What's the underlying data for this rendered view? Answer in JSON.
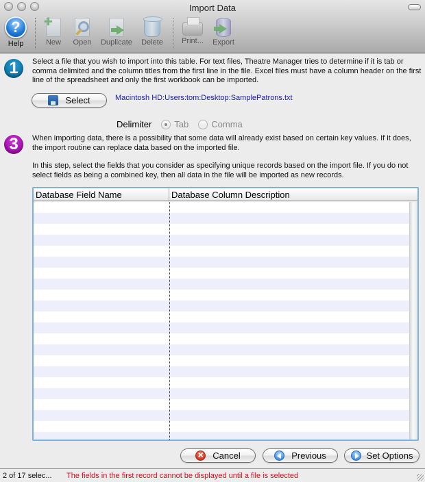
{
  "window": {
    "title": "Import Data"
  },
  "toolbar": {
    "items": [
      {
        "label": "Help",
        "icon": "help-icon",
        "enabled": true
      },
      {
        "label": "New",
        "icon": "new-document-icon",
        "enabled": false
      },
      {
        "label": "Open",
        "icon": "open-magnifier-icon",
        "enabled": false
      },
      {
        "label": "Duplicate",
        "icon": "duplicate-icon",
        "enabled": false
      },
      {
        "label": "Delete",
        "icon": "trash-icon",
        "enabled": false
      },
      {
        "label": "Print...",
        "icon": "printer-icon",
        "enabled": false
      },
      {
        "label": "Export",
        "icon": "export-database-icon",
        "enabled": false
      }
    ]
  },
  "step1": {
    "number": "1",
    "color": "#0a6f9e",
    "text": "Select a file that you wish to import into this table.  For text files, Theatre Manager tries to determine if it is tab or comma delimited and the column titles from the first line in the file.  Excel files must have a column header on the first line of the spreadsheet and only the first workbook can be imported.",
    "select_label": "Select",
    "file_path": "Macintosh HD:Users:tom:Desktop:SamplePatrons.txt",
    "delimiter_label": "Delimiter",
    "delimiter_options": [
      {
        "label": "Tab",
        "selected": true
      },
      {
        "label": "Comma",
        "selected": false
      }
    ]
  },
  "step3": {
    "number": "3",
    "color": "#9b0aa4",
    "text1": "When importing data, there is a possibility that some data will already exist based on certain key values.  If it does, the import routine can replace data based on the imported file.",
    "text2": "In this step, select the fields that you consider as specifying unique records based on the import file.   If you do not select fields as being a combined key, then all data in the file will be imported as new records."
  },
  "table": {
    "columns": [
      "Database Field Name",
      "Database Column Description"
    ],
    "rows": []
  },
  "buttons": {
    "cancel": "Cancel",
    "previous": "Previous",
    "set_options": "Set Options"
  },
  "status": {
    "count": "2 of 17 selec...",
    "message": "The fields in the first record cannot be displayed until a file is selected",
    "message_color": "#d4101c"
  }
}
